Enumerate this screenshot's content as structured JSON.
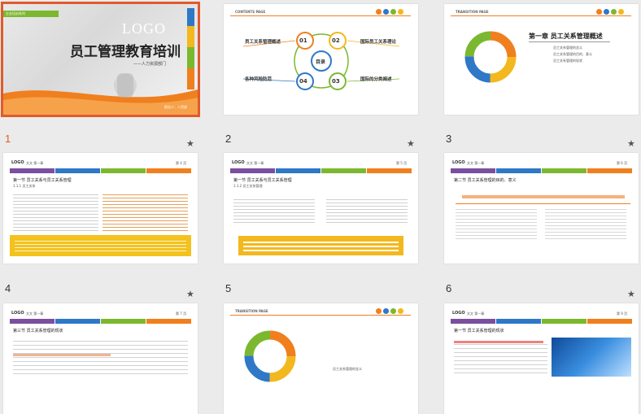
{
  "thumbnails": [
    {
      "id": "s1",
      "number": "",
      "cover_title": "员工管理教育培训",
      "cover_logo": "LOGO",
      "cover_subtitle": "——人力资源部门",
      "cover_tag": "企业培训系列",
      "cover_reporter": "报告人：人资部"
    },
    {
      "id": "s2",
      "number": "",
      "header": "CONTENTS PAGE",
      "center_label": "目录",
      "items": [
        {
          "n": "01",
          "label": "员工关系管理概述"
        },
        {
          "n": "02",
          "label": "国际员工关系理论"
        },
        {
          "n": "03",
          "label": "国际的分类阐述"
        },
        {
          "n": "04",
          "label": "各种风险防范"
        }
      ]
    },
    {
      "id": "s3",
      "number": "",
      "header": "TRANSITION PAGE",
      "chapter": "第一章  员工关系管理概述",
      "bullets": [
        "员工关系管理的含义",
        "员工关系管理的目的、意义",
        "员工关系管理的现状"
      ]
    },
    {
      "id": "s4",
      "number": "1",
      "logo": "LOGO",
      "crumb": "文文  第一章",
      "page": "第 4 页",
      "section": "第一节  员工关系与员工关系管理",
      "sub": "1.1.1 员工关系"
    },
    {
      "id": "s5",
      "number": "2",
      "logo": "LOGO",
      "crumb": "文文  第一章",
      "page": "第 5 页",
      "section": "第一节  员工关系与员工关系管理",
      "sub": "1.1.2 员工关系管理"
    },
    {
      "id": "s6",
      "number": "3",
      "logo": "LOGO",
      "crumb": "文文  第一章",
      "page": "第 6 页",
      "section": "第二节  员工关系管理的目的、意义"
    },
    {
      "id": "s7",
      "number": "4",
      "logo": "LOGO",
      "crumb": "文文  第一章",
      "page": "第 7 页",
      "section": "第三节  员工关系管理的现状"
    },
    {
      "id": "s8",
      "number": "5",
      "header": "TRANSITION PAGE",
      "bullets": [
        "员工关系管理的含义"
      ]
    },
    {
      "id": "s9",
      "number": "6",
      "logo": "LOGO",
      "crumb": "文文  第一章",
      "page": "第 9 页",
      "section": "第一节  员工关系管理的现状"
    }
  ],
  "nav_tabs": [
    "员工关系管理概述",
    "国际员工关系理论",
    "国际的分类阐述",
    "各种风险防范"
  ],
  "star_glyph": "★",
  "colors": {
    "orange": "#f07f1e",
    "green": "#7cb82f",
    "blue": "#2e78c7",
    "yellow": "#f3b81d",
    "purple": "#7b4fa0",
    "selected": "#e05a2c"
  }
}
